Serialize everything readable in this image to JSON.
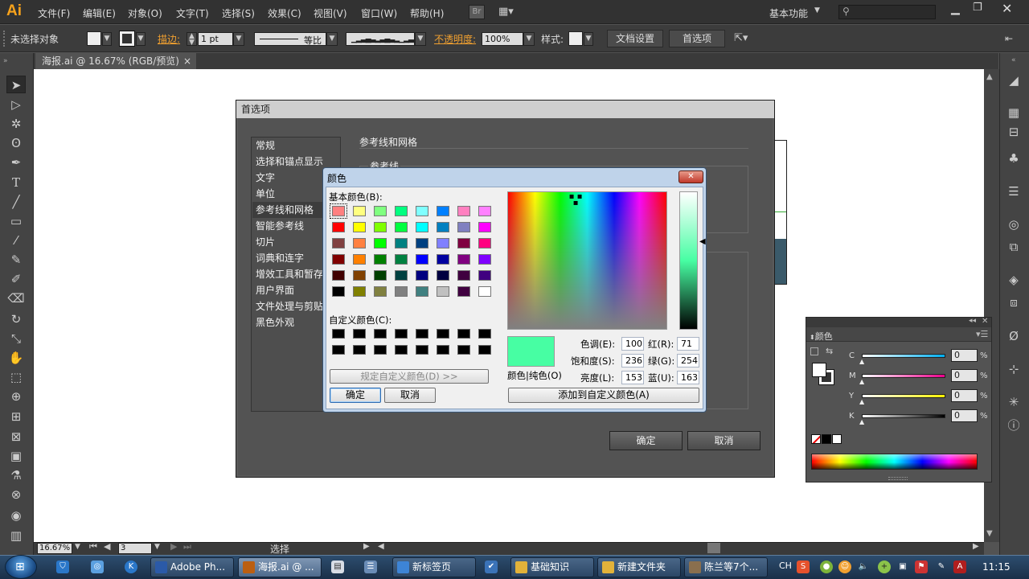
{
  "app": {
    "logo": "Ai"
  },
  "menu": [
    "文件(F)",
    "编辑(E)",
    "对象(O)",
    "文字(T)",
    "选择(S)",
    "效果(C)",
    "视图(V)",
    "窗口(W)",
    "帮助(H)"
  ],
  "menubar_extra": {
    "br": "Br",
    "workspace": "基本功能",
    "search_placeholder": ""
  },
  "control": {
    "selection": "未选择对象",
    "stroke_label": "描边:",
    "stroke_value": "1 pt",
    "stroke_style": "等比",
    "opacity_label": "不透明度:",
    "opacity_value": "100%",
    "style_label": "样式:",
    "doc_setup": "文档设置",
    "prefs": "首选项"
  },
  "doc": {
    "tab_title": "海报.ai @ 16.67% (RGB/预览)",
    "close": "×"
  },
  "status": {
    "zoom": "16.67%",
    "artboard": "3",
    "tool": "选择"
  },
  "prefs": {
    "title": "首选项",
    "items": [
      "常规",
      "选择和锚点显示",
      "文字",
      "单位",
      "参考线和网格",
      "智能参考线",
      "切片",
      "词典和连字",
      "增效工具和暂存盘",
      "用户界面",
      "文件处理与剪贴板",
      "黑色外观"
    ],
    "section": "参考线和网格",
    "sub_section": "参考线",
    "ok": "确定",
    "cancel": "取消"
  },
  "color_dialog": {
    "title": "颜色",
    "close": "✕",
    "basic_label": "基本颜色(B):",
    "custom_label": "自定义颜色(C):",
    "define_btn": "规定自定义颜色(D) >>",
    "ok": "确定",
    "cancel": "取消",
    "solid_label": "颜色|纯色(O)",
    "hue_label": "色调(E):",
    "hue": "100",
    "sat_label": "饱和度(S):",
    "sat": "236",
    "lum_label": "亮度(L):",
    "lum": "153",
    "red_label": "红(R):",
    "red": "71",
    "green_label": "绿(G):",
    "green": "254",
    "blue_label": "蓝(U):",
    "blue": "163",
    "add_custom": "添加到自定义颜色(A)",
    "selected_color": "#47fea3",
    "basic_colors": [
      "#ff8080",
      "#ffff80",
      "#80ff80",
      "#00ff80",
      "#80ffff",
      "#0080ff",
      "#ff80c0",
      "#ff80ff",
      "#ff0000",
      "#ffff00",
      "#80ff00",
      "#00ff40",
      "#00ffff",
      "#0080c0",
      "#8080c0",
      "#ff00ff",
      "#804040",
      "#ff8040",
      "#00ff00",
      "#008080",
      "#004080",
      "#8080ff",
      "#800040",
      "#ff0080",
      "#800000",
      "#ff8000",
      "#008000",
      "#008040",
      "#0000ff",
      "#0000a0",
      "#800080",
      "#8000ff",
      "#400000",
      "#804000",
      "#004000",
      "#004040",
      "#000080",
      "#000040",
      "#400040",
      "#400080",
      "#000000",
      "#808000",
      "#808040",
      "#808080",
      "#408080",
      "#c0c0c0",
      "#400040",
      "#ffffff"
    ]
  },
  "color_panel": {
    "title": "颜色",
    "channels": [
      {
        "name": "C",
        "value": "0",
        "unit": "%"
      },
      {
        "name": "M",
        "value": "0",
        "unit": "%"
      },
      {
        "name": "Y",
        "value": "0",
        "unit": "%"
      },
      {
        "name": "K",
        "value": "0",
        "unit": "%"
      }
    ]
  },
  "taskbar": {
    "buttons": [
      "Adobe Ph...",
      "海报.ai @ ...",
      "新标签页",
      "基础知识",
      "新建文件夹",
      "陈兰等7个..."
    ],
    "tray": {
      "lang": "CH",
      "time": "11:15"
    }
  }
}
